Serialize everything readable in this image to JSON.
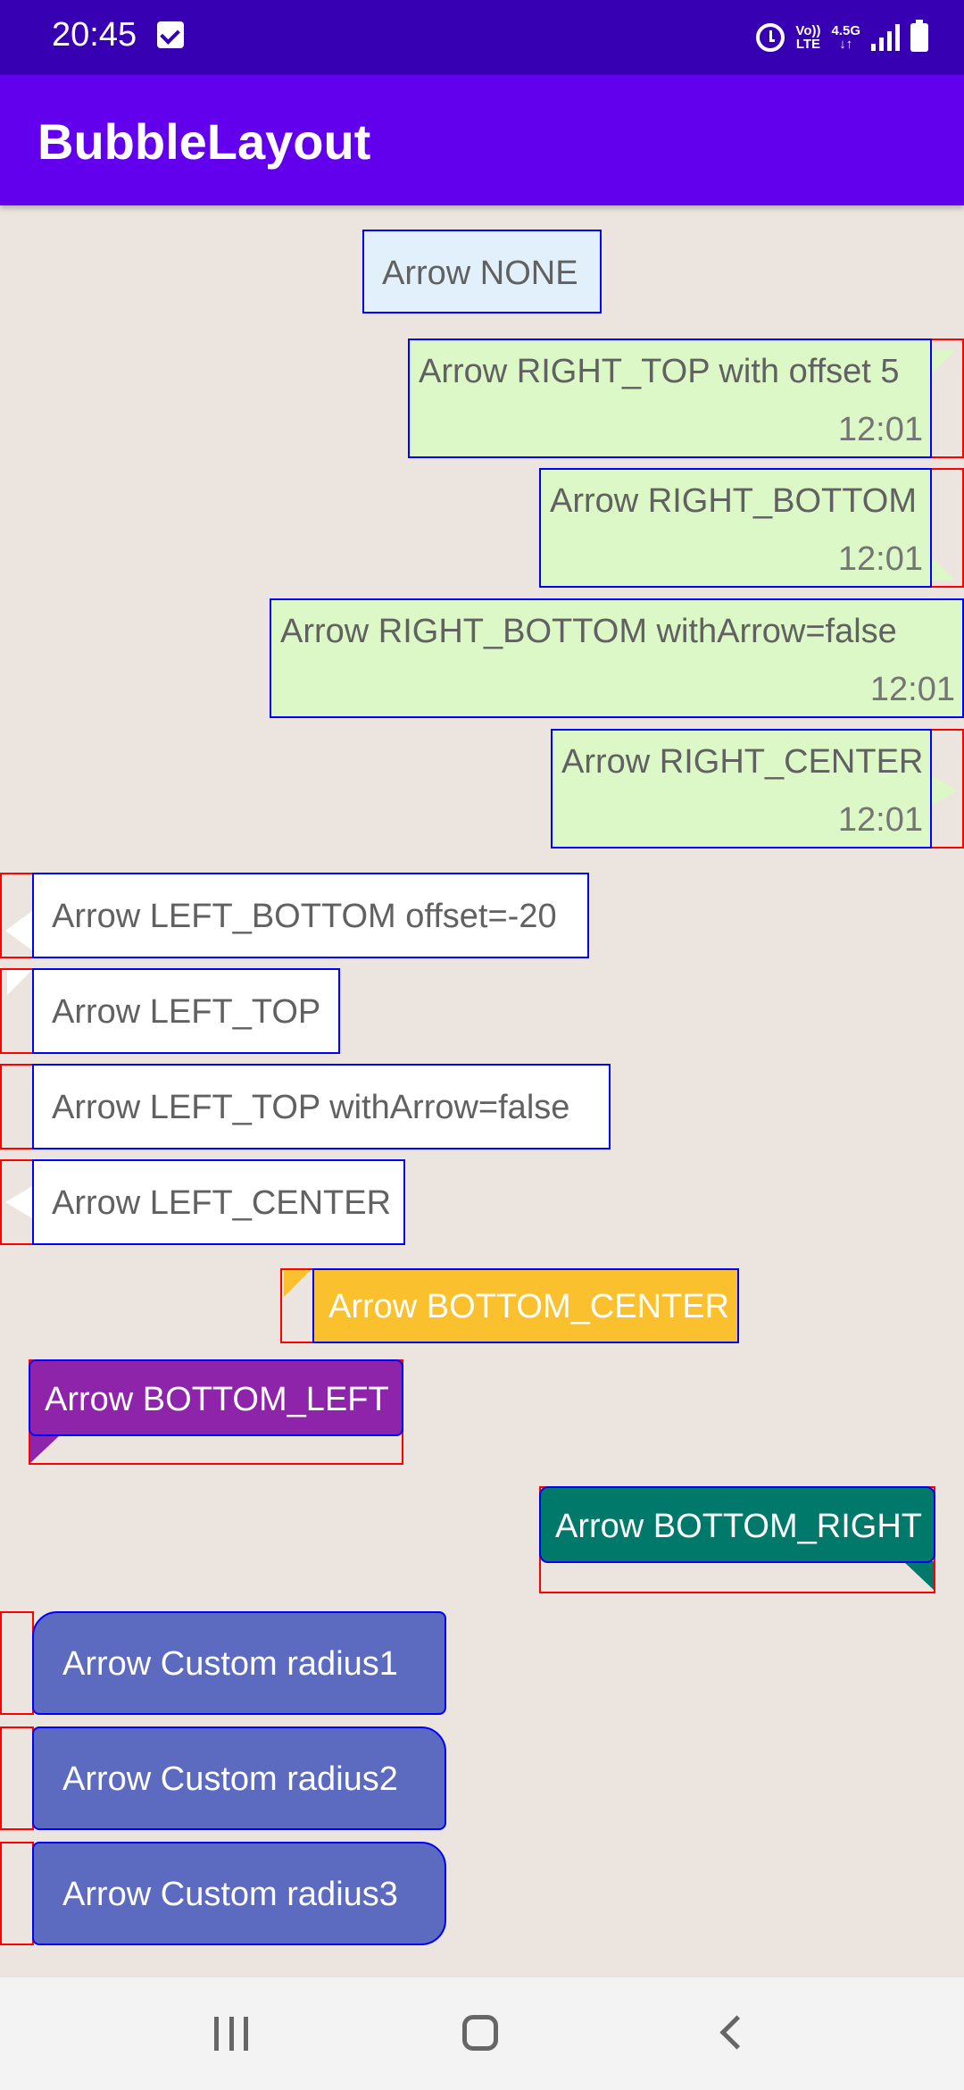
{
  "status_bar": {
    "time": "20:45",
    "volte_top": "Vo))",
    "volte_bottom": "LTE",
    "network_top": "4.5G",
    "network_bottom": "↓↑"
  },
  "app_bar": {
    "title": "BubbleLayout"
  },
  "bubbles": {
    "arrow_none": "Arrow NONE",
    "right_top": {
      "text": "Arrow RIGHT_TOP with offset 5",
      "time": "12:01"
    },
    "right_bottom": {
      "text": "Arrow RIGHT_BOTTOM",
      "time": "12:01"
    },
    "right_bottom_no_arrow": {
      "text": "Arrow RIGHT_BOTTOM withArrow=false",
      "time": "12:01"
    },
    "right_center": {
      "text": "Arrow RIGHT_CENTER",
      "time": "12:01"
    },
    "left_bottom": "Arrow LEFT_BOTTOM offset=-20",
    "left_top": "Arrow LEFT_TOP",
    "left_top_no_arrow": "Arrow LEFT_TOP withArrow=false",
    "left_center": "Arrow LEFT_CENTER",
    "bottom_center": "Arrow BOTTOM_CENTER",
    "bottom_left": "Arrow BOTTOM_LEFT",
    "bottom_right": "Arrow BOTTOM_RIGHT",
    "custom_radius1": "Arrow Custom radius1",
    "custom_radius2": "Arrow Custom radius2",
    "custom_radius3": "Arrow Custom radius3"
  },
  "colors": {
    "status_bar": "#3700b3",
    "app_bar": "#6200ee",
    "background": "#ece5df",
    "bubble_green": "#dcf8c6",
    "bubble_yellow": "#fbc02d",
    "bubble_purple": "#8e24aa",
    "bubble_teal": "#00796b",
    "bubble_indigo": "#5c6bc0",
    "debug_frame": "#ff0000",
    "debug_bubble": "#0000ff"
  },
  "navigation": {
    "recent_icon": "recent-apps-icon",
    "home_icon": "home-icon",
    "back_icon": "back-icon"
  }
}
